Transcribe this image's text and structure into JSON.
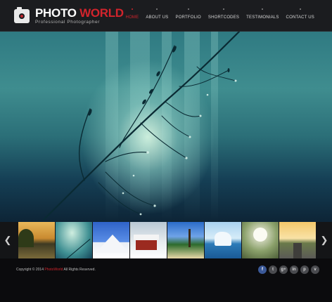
{
  "header": {
    "brand_word1": "PHOTO",
    "brand_word2": "WORLD",
    "tagline": "Professional Photographer",
    "nav": [
      {
        "label": "Home",
        "active": true
      },
      {
        "label": "About Us"
      },
      {
        "label": "Portfolio"
      },
      {
        "label": "Shortcodes"
      },
      {
        "label": "Testimonials"
      },
      {
        "label": "Contact Us"
      }
    ]
  },
  "hero": {
    "image": "plant-stem-with-dew-drops"
  },
  "strip": {
    "prev_icon": "chevron-left-icon",
    "next_icon": "chevron-right-icon",
    "thumbnails": [
      "autumn-lake",
      "plant-with-dew",
      "snowy-mountain",
      "red-house-in-snow",
      "tropical-beach",
      "iceberg",
      "dandelion",
      "road-at-sunset"
    ]
  },
  "footer": {
    "copyright_prefix": "Copyright © 2014",
    "copyright_name": "PhotoWorld",
    "copyright_suffix": "All Rights Reserved.",
    "socials": [
      {
        "name": "facebook-icon",
        "glyph": "f"
      },
      {
        "name": "twitter-icon",
        "glyph": "t"
      },
      {
        "name": "google-plus-icon",
        "glyph": "g+"
      },
      {
        "name": "linkedin-icon",
        "glyph": "in"
      },
      {
        "name": "pinterest-icon",
        "glyph": "p"
      },
      {
        "name": "vimeo-icon",
        "glyph": "v"
      }
    ]
  },
  "colors": {
    "accent": "#d2242c",
    "header_bg": "#1b1c1f",
    "footer_bg": "#0b0b0d"
  }
}
